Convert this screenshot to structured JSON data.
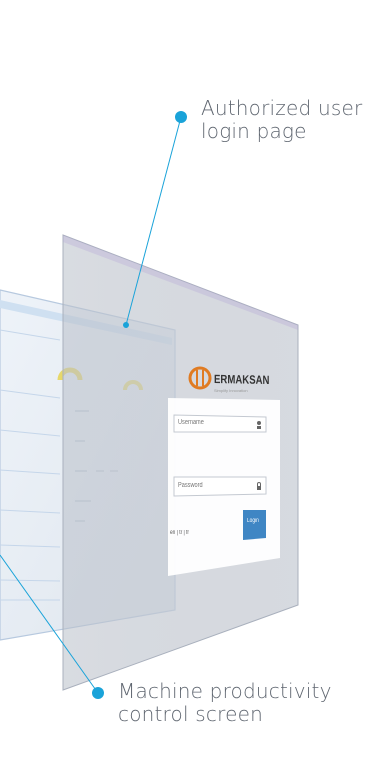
{
  "callouts": {
    "login_page": "Authorized user login page",
    "productivity_screen": "Machine productivity control screen"
  },
  "login_panel": {
    "brand": "ERMAKSAN",
    "tagline": "Simplify Innovation",
    "username_placeholder": "Username",
    "password_placeholder": "Password",
    "login_button": "Login",
    "languages": "en | tr | fr"
  },
  "icons": {
    "user": "user-icon",
    "lock": "lock-icon",
    "logo": "ermaksan-logo-icon"
  },
  "colors": {
    "accent_line": "#1aa3d9",
    "accent_dot": "#1aa3d9",
    "login_button": "#3f86c4",
    "logo_orange": "#e07b22",
    "panel_glass": "#c9ced6"
  }
}
